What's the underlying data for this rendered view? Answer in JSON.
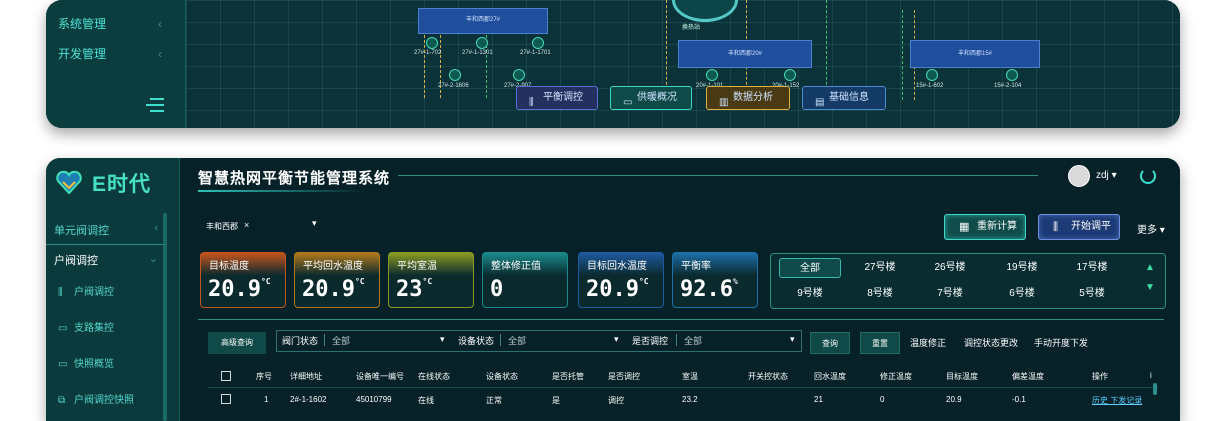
{
  "top_panel": {
    "menu": [
      {
        "label": "系统管理"
      },
      {
        "label": "开发管理"
      }
    ],
    "map": {
      "blocks": [
        "丰和西郡27#",
        "丰和西郡20#",
        "丰和西郡15#"
      ],
      "hub_label": "换热站",
      "nodes": [
        "27#-1-702",
        "27#-1-1301",
        "27#-1-1701",
        "27#-2-1606",
        "27#-2-907",
        "20#-1-101",
        "20#-1-152",
        "15#-1-602",
        "15#-2-104"
      ],
      "buttons": [
        "平衡调控",
        "供暖概况",
        "数据分析",
        "基础信息"
      ]
    }
  },
  "bottom_panel": {
    "logo": {
      "text": "E时代"
    },
    "sidebar": {
      "items": [
        {
          "label": "单元阀调控"
        },
        {
          "label": "户阀调控"
        }
      ],
      "sub_items": [
        {
          "label": "户阀调控"
        },
        {
          "label": "支路集控"
        },
        {
          "label": "快照概览"
        },
        {
          "label": "户阀调控快照"
        }
      ]
    },
    "header": {
      "title": "智慧热网平衡节能管理系统",
      "user": "zdj"
    },
    "station": {
      "name": "丰和西郡",
      "clear": "×"
    },
    "actions": {
      "recalc": "重新计算",
      "balance": "开始调平",
      "more": "更多"
    },
    "stats": [
      {
        "label": "目标温度",
        "value": "20.9",
        "unit": "°C",
        "color": "#c4541c"
      },
      {
        "label": "平均回水温度",
        "value": "20.9",
        "unit": "°C",
        "color": "#b0781a"
      },
      {
        "label": "平均室温",
        "value": "23",
        "unit": "°C",
        "color": "#8a9a22"
      },
      {
        "label": "整体修正值",
        "value": "0",
        "unit": "",
        "color": "#1a8a8a"
      },
      {
        "label": "目标回水温度",
        "value": "20.9",
        "unit": "°C",
        "color": "#1d5aa0"
      },
      {
        "label": "平衡率",
        "value": "92.6",
        "unit": "%",
        "color": "#1c6fa8"
      }
    ],
    "buildings": [
      [
        "全部",
        "27号楼",
        "26号楼",
        "19号楼",
        "17号楼"
      ],
      [
        "9号楼",
        "8号楼",
        "7号楼",
        "6号楼",
        "5号楼"
      ]
    ],
    "filters": {
      "advanced": "高级查询",
      "valve_state_label": "阀门状态",
      "valve_state_value": "全部",
      "device_state_label": "设备状态",
      "device_state_value": "全部",
      "regulated_label": "是否调控",
      "regulated_value": "全部",
      "query": "查询",
      "reset": "重置",
      "links": [
        "温度修正",
        "调控状态更改",
        "手动开度下发"
      ]
    },
    "table": {
      "headers": [
        "序号",
        "详细地址",
        "设备唯一编号",
        "在线状态",
        "设备状态",
        "是否托管",
        "是否调控",
        "室温",
        "开关控状态",
        "回水温度",
        "修正温度",
        "目标温度",
        "偏差温度",
        "操作",
        "i"
      ],
      "rows": [
        [
          "1",
          "2#-1-1602",
          "45010799",
          "在线",
          "正常",
          "是",
          "调控",
          "23.2",
          "",
          "21",
          "0",
          "20.9",
          "-0.1",
          "历史 下发记录"
        ]
      ]
    }
  }
}
